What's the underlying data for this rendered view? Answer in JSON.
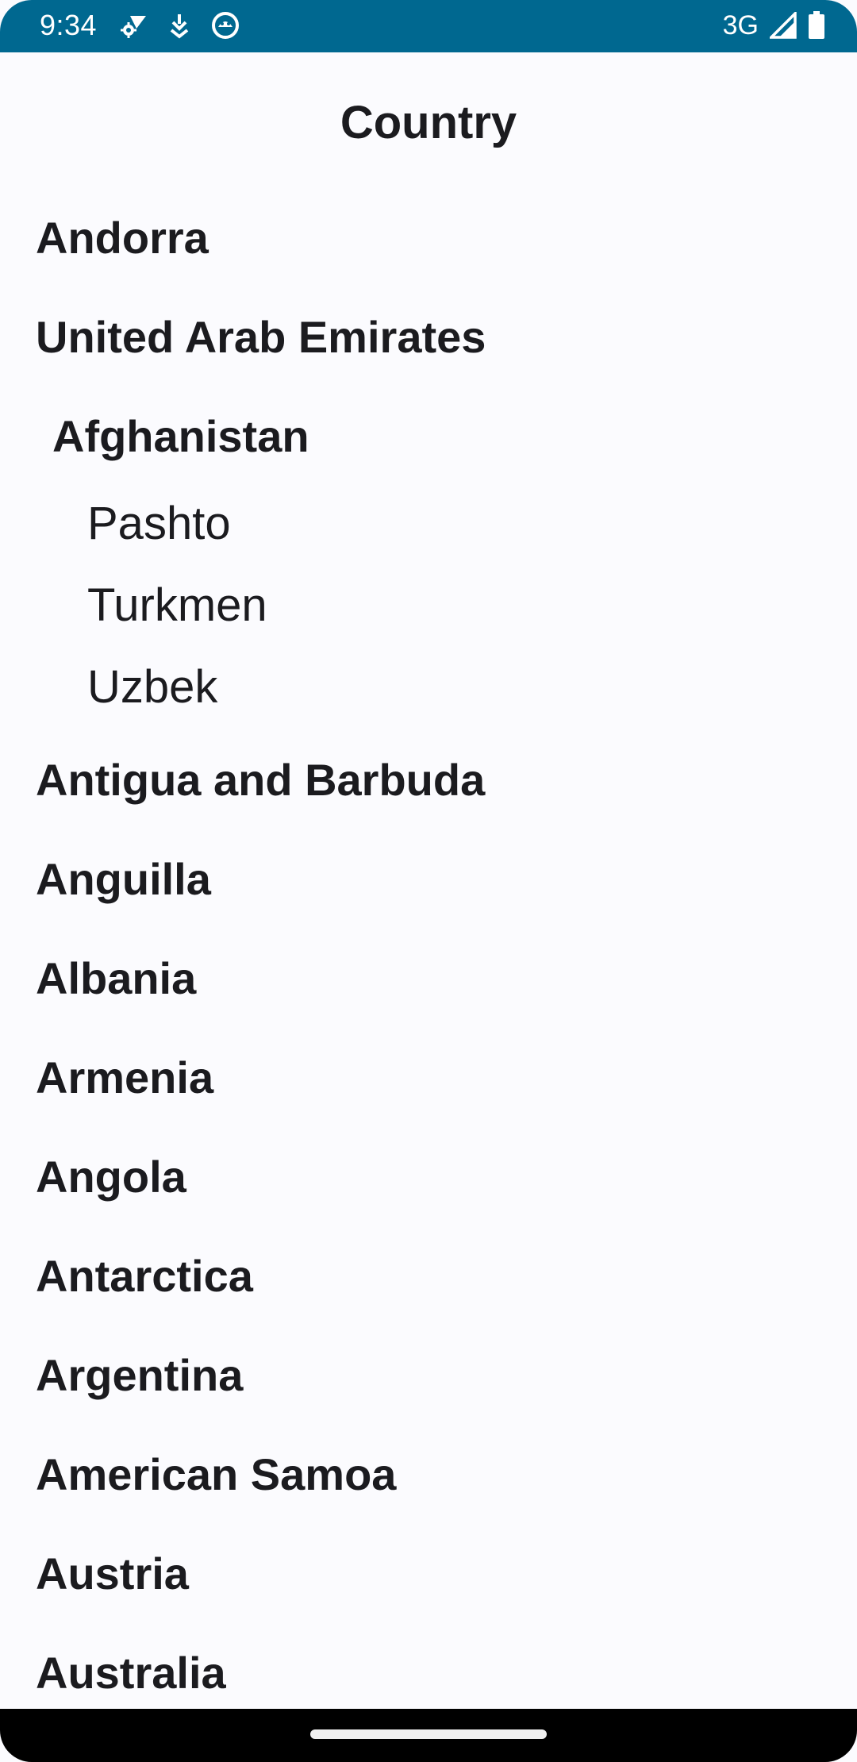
{
  "status_bar": {
    "time": "9:34",
    "network": "3G",
    "left_icons": [
      "settings-wifi-icon",
      "download-icon",
      "android-debug-icon"
    ],
    "right_icons": [
      "signal-icon",
      "battery-icon"
    ],
    "background_color": "#006890"
  },
  "header": {
    "title": "Country"
  },
  "list": {
    "items": [
      {
        "name": "Andorra"
      },
      {
        "name": "United Arab Emirates"
      },
      {
        "name": "Afghanistan",
        "languages": [
          "Pashto",
          "Turkmen",
          "Uzbek"
        ]
      },
      {
        "name": "Antigua and Barbuda"
      },
      {
        "name": "Anguilla"
      },
      {
        "name": "Albania"
      },
      {
        "name": "Armenia"
      },
      {
        "name": "Angola"
      },
      {
        "name": "Antarctica"
      },
      {
        "name": "Argentina"
      },
      {
        "name": "American Samoa"
      },
      {
        "name": "Austria"
      },
      {
        "name": "Australia"
      }
    ]
  },
  "colors": {
    "background": "#fbfbfe",
    "text": "#1b1b1f"
  }
}
